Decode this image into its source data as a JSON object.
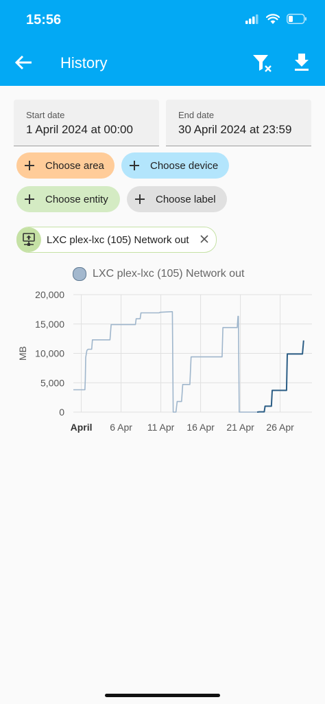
{
  "status_bar": {
    "time": "15:56"
  },
  "header": {
    "title": "History"
  },
  "dates": {
    "start": {
      "label": "Start date",
      "value": "1 April 2024 at 00:00"
    },
    "end": {
      "label": "End date",
      "value": "30 April 2024 at 23:59"
    }
  },
  "targets": {
    "area": "Choose area",
    "device": "Choose device",
    "entity": "Choose entity",
    "label": "Choose label",
    "colors": {
      "area": "#ffcc99",
      "device": "#b3e5fc",
      "entity": "#d4ebc3",
      "label": "#e0e0e0"
    }
  },
  "selected_entity": {
    "label": "LXC plex-lxc (105) Network out",
    "icon": "server-network-icon"
  },
  "chart_data": {
    "type": "line",
    "legend": "LXC plex-lxc (105) Network out",
    "ylabel": "MB",
    "ylim": [
      0,
      20000
    ],
    "yticks": [
      "0",
      "5,000",
      "10,000",
      "15,000",
      "20,000"
    ],
    "yticks_values": [
      0,
      5000,
      10000,
      15000,
      20000
    ],
    "xticks": [
      "April",
      "6 Apr",
      "11 Apr",
      "16 Apr",
      "21 Apr",
      "26 Apr"
    ],
    "xticks_days": [
      1,
      6,
      11,
      16,
      21,
      26
    ],
    "xlim_days": [
      0.0,
      30.0
    ],
    "colors": {
      "faded": "#9fb6cc",
      "active": "#2b5d85"
    },
    "series": [
      {
        "style": "faded",
        "points": [
          [
            0.0,
            3800
          ],
          [
            1.45,
            3800
          ],
          [
            1.5,
            5500
          ],
          [
            1.55,
            9300
          ],
          [
            1.7,
            10500
          ],
          [
            1.85,
            10700
          ],
          [
            2.3,
            10700
          ],
          [
            2.4,
            12300
          ],
          [
            4.6,
            12300
          ],
          [
            4.75,
            14900
          ],
          [
            7.8,
            14900
          ],
          [
            7.9,
            15900
          ],
          [
            8.4,
            15900
          ],
          [
            8.5,
            16900
          ],
          [
            10.8,
            16900
          ],
          [
            10.9,
            17000
          ],
          [
            12.3,
            17100
          ],
          [
            12.45,
            17100
          ],
          [
            12.55,
            0
          ],
          [
            12.9,
            0
          ],
          [
            13.05,
            1800
          ],
          [
            13.6,
            1800
          ],
          [
            13.75,
            4700
          ],
          [
            14.65,
            4700
          ],
          [
            14.8,
            9400
          ],
          [
            18.7,
            9400
          ],
          [
            18.8,
            14400
          ],
          [
            20.6,
            14400
          ],
          [
            20.7,
            16300
          ],
          [
            20.75,
            16300
          ],
          [
            20.85,
            0
          ],
          [
            23.1,
            0
          ]
        ]
      },
      {
        "style": "active",
        "points": [
          [
            23.1,
            0
          ],
          [
            23.4,
            50
          ],
          [
            24.0,
            50
          ],
          [
            24.1,
            1000
          ],
          [
            24.9,
            1000
          ],
          [
            25.0,
            3700
          ],
          [
            26.8,
            3700
          ],
          [
            26.9,
            9900
          ],
          [
            28.8,
            9900
          ],
          [
            28.95,
            12200
          ]
        ]
      }
    ]
  }
}
